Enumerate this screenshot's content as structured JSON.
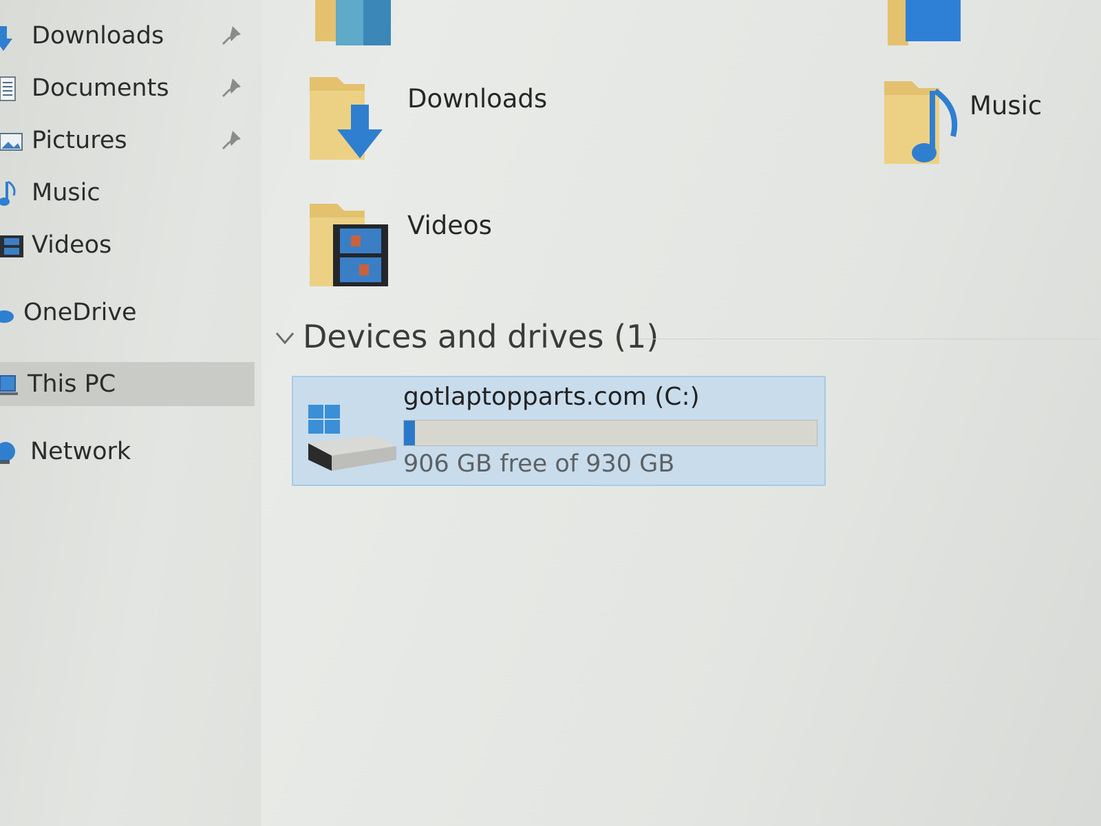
{
  "sidebar": {
    "items": [
      {
        "label": "Downloads",
        "icon": "download-arrow-icon",
        "pinned": true
      },
      {
        "label": "Documents",
        "icon": "documents-icon",
        "pinned": true
      },
      {
        "label": "Pictures",
        "icon": "pictures-icon",
        "pinned": true
      },
      {
        "label": "Music",
        "icon": "music-note-icon",
        "pinned": false
      },
      {
        "label": "Videos",
        "icon": "film-icon",
        "pinned": false
      },
      {
        "label": "OneDrive",
        "icon": "cloud-icon",
        "pinned": false
      },
      {
        "label": "This PC",
        "icon": "computer-icon",
        "pinned": false,
        "selected": true
      },
      {
        "label": "Network",
        "icon": "network-icon",
        "pinned": false
      }
    ]
  },
  "folders": [
    {
      "name": "Downloads",
      "icon": "downloads-folder-icon"
    },
    {
      "name": "Music",
      "icon": "music-folder-icon"
    },
    {
      "name": "Videos",
      "icon": "videos-folder-icon"
    }
  ],
  "devices_section": {
    "title": "Devices and drives (1)",
    "expanded": true
  },
  "drive": {
    "name": "gotlaptopparts.com (C:)",
    "free_text": "906 GB free of 930 GB",
    "used_fraction": 0.026,
    "icon": "windows-drive-icon"
  },
  "colors": {
    "accent": "#2a79c9",
    "folder_yellow": "#e8c46a",
    "selection": "#c8dcec"
  }
}
